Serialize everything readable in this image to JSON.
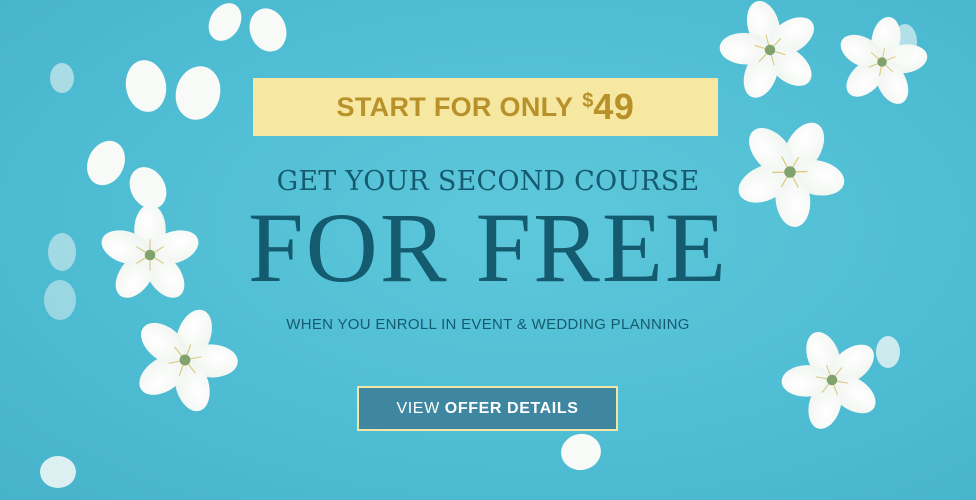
{
  "promo": {
    "text": "START FOR ONLY",
    "currency": "$",
    "price": "49"
  },
  "headline": {
    "line1": "GET YOUR SECOND COURSE",
    "line2": "FOR FREE"
  },
  "subtext": "WHEN YOU ENROLL IN EVENT & WEDDING PLANNING",
  "cta": {
    "label_light": "VIEW",
    "label_bold": "OFFER DETAILS"
  },
  "colors": {
    "background": "#4fbdd3",
    "promo_background": "#f6e8a0",
    "promo_text": "#b8912a",
    "headline": "#155b6f",
    "cta_background": "#3f87a0",
    "cta_border": "#f1e6a6"
  },
  "decorations": {
    "icons": [
      "blossom-flower-icon",
      "petal-icon"
    ]
  }
}
